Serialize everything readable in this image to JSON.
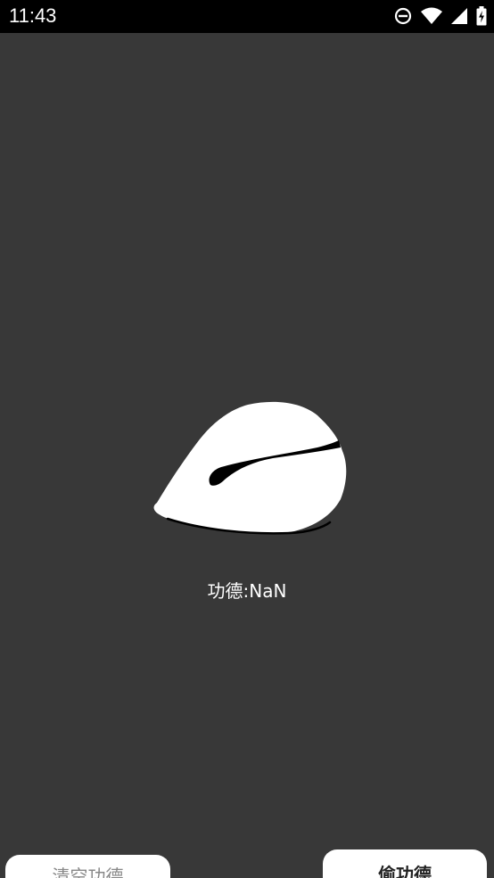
{
  "status_bar": {
    "time": "11:43",
    "icons": [
      "do-not-disturb-icon",
      "wifi-icon",
      "cellular-signal-icon",
      "battery-charging-icon"
    ]
  },
  "main": {
    "merit_label": "功德:NaN",
    "wooden_fish_icon": "wooden-fish-icon"
  },
  "buttons": {
    "clear_merit": "清空功德",
    "steal_merit": "偷功德"
  },
  "colors": {
    "background": "#383838",
    "status_bar": "#000000",
    "text": "#ffffff",
    "button_bg": "#ffffff"
  }
}
